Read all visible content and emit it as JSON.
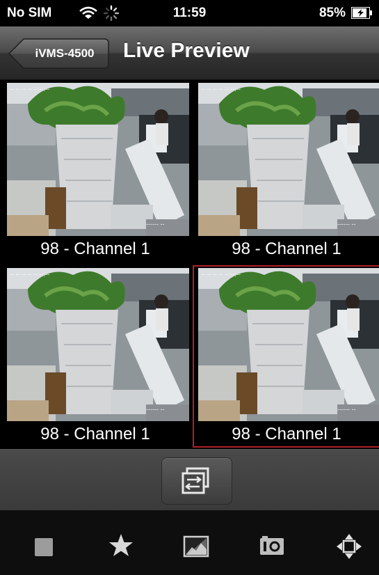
{
  "status_bar": {
    "carrier": "No SIM",
    "time": "11:59",
    "battery": "85%"
  },
  "nav": {
    "back_label": "iVMS-4500",
    "title": "Live Preview"
  },
  "tiles": [
    {
      "caption": "98 - Channel 1"
    },
    {
      "caption": "98 - Channel 1"
    },
    {
      "caption": "98 - Channel 1"
    },
    {
      "caption": "98 - Channel 1"
    }
  ],
  "selected_tile": 4,
  "colors": {
    "selection": "#b0202a",
    "navbar": "#4a4a4a"
  },
  "toolbar": {
    "icons": [
      "stop-icon",
      "favorite-star-icon",
      "image-quality-icon",
      "capture-camera-icon",
      "ptz-direction-icon"
    ]
  },
  "switch_icon": "window-switch-icon"
}
